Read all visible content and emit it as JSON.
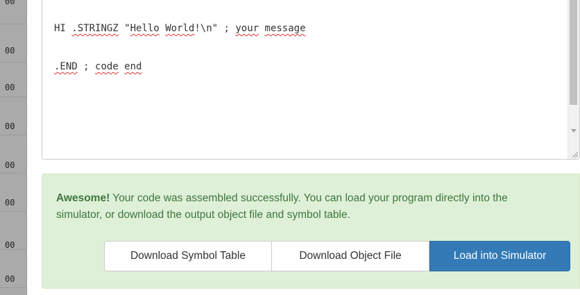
{
  "gutter": {
    "labels": [
      "00",
      "00",
      "00",
      "00",
      "00",
      "00",
      "00",
      "00"
    ]
  },
  "editor": {
    "line1": {
      "label": "HI",
      "directive": ".STRINGZ",
      "str_hello": "Hello",
      "str_world": "World",
      "str_rest": "!\\n\"",
      "comment_prefix": " ; ",
      "comment_word1": "your",
      "comment_word2": "message"
    },
    "line2": {
      "directive": ".END",
      "comment_prefix": " ; ",
      "comment_word1": "code",
      "comment_word2": "end"
    }
  },
  "alert": {
    "strong": "Awesome!",
    "message": " Your code was assembled successfully. You can load your program directly into the simulator, or download the output object file and symbol table."
  },
  "buttons": {
    "download_symbol_table": "Download Symbol Table",
    "download_object_file": "Download Object File",
    "load_into_simulator": "Load into Simulator"
  },
  "colors": {
    "alert_bg": "#dff0d8",
    "alert_text": "#3c763d",
    "primary_button": "#337ab7",
    "spellcheck": "#e03030"
  }
}
